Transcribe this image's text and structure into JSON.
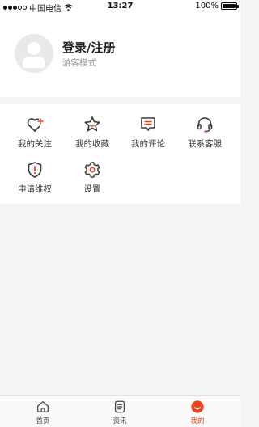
{
  "status_bar": {
    "carrier": "中国电信",
    "time": "13:27",
    "battery": "100%",
    "battery_level": 1.0,
    "signal_bars": 5,
    "signal_filled": 3
  },
  "profile": {
    "title": "登录/注册",
    "subtitle": "游客模式"
  },
  "menu": {
    "items": [
      {
        "label": "我的关注",
        "icon": "heart-plus-icon"
      },
      {
        "label": "我的收藏",
        "icon": "star-icon"
      },
      {
        "label": "我的评论",
        "icon": "comment-icon"
      },
      {
        "label": "联系客服",
        "icon": "headset-icon"
      },
      {
        "label": "申请维权",
        "icon": "shield-alert-icon"
      },
      {
        "label": "设置",
        "icon": "gear-icon"
      }
    ]
  },
  "tab_bar": {
    "tabs": [
      {
        "label": "首页",
        "icon": "home-icon",
        "active": false
      },
      {
        "label": "资讯",
        "icon": "news-icon",
        "active": false
      },
      {
        "label": "我的",
        "icon": "profile-icon",
        "active": true
      }
    ]
  },
  "colors": {
    "accent": "#e8421e",
    "icon_stroke": "#3a3a3a",
    "page_background": "#f4f5f7"
  }
}
